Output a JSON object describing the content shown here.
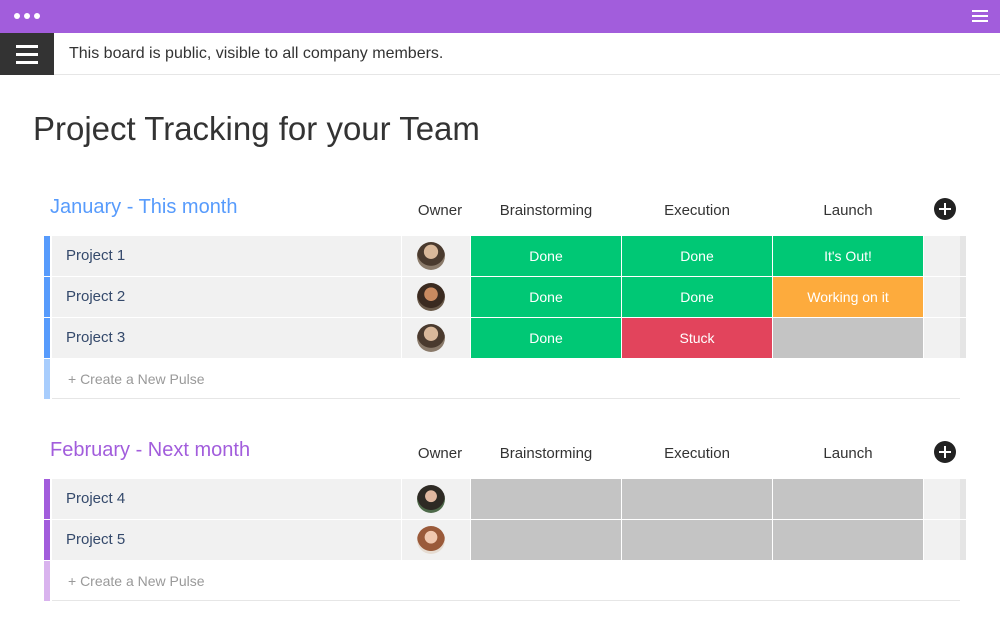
{
  "colors": {
    "titlebar": "#a25ddc",
    "done": "#00c875",
    "stuck": "#e2445c",
    "working": "#fdab3d",
    "empty": "#c4c4c4",
    "january": "#579bfc",
    "january_light": "#a8cdfd",
    "february": "#a25ddc",
    "february_light": "#d9b3ee"
  },
  "topbar": {
    "menu_icon": "hamburger-icon",
    "notice": "This board is public, visible to all company members."
  },
  "board": {
    "title": "Project Tracking for your Team"
  },
  "columns": {
    "owner": "Owner",
    "brainstorming": "Brainstorming",
    "execution": "Execution",
    "launch": "Launch"
  },
  "groups": [
    {
      "title": "January - This month",
      "color": "#579bfc",
      "rows": [
        {
          "name": "Project 1",
          "brainstorming": "Done",
          "execution": "Done",
          "launch": "It's Out!"
        },
        {
          "name": "Project 2",
          "brainstorming": "Done",
          "execution": "Done",
          "launch": "Working on it"
        },
        {
          "name": "Project 3",
          "brainstorming": "Done",
          "execution": "Stuck",
          "launch": ""
        }
      ],
      "new_pulse": "+ Create a New Pulse"
    },
    {
      "title": "February - Next month",
      "color": "#a25ddc",
      "rows": [
        {
          "name": "Project 4",
          "brainstorming": "",
          "execution": "",
          "launch": ""
        },
        {
          "name": "Project 5",
          "brainstorming": "",
          "execution": "",
          "launch": ""
        }
      ],
      "new_pulse": "+ Create a New Pulse"
    }
  ]
}
